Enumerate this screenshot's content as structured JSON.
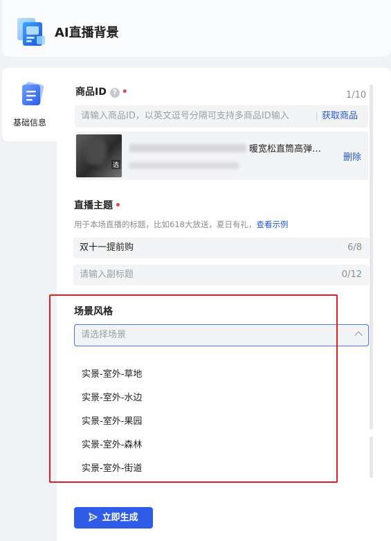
{
  "app": {
    "title": "AI直播背景"
  },
  "sidebar": {
    "items": [
      {
        "label": "基础信息",
        "icon": "document-icon"
      }
    ]
  },
  "form": {
    "product_id": {
      "label": "商品ID",
      "help_icon": "?",
      "required_mark": "•",
      "count": "1/10",
      "placeholder": "请输入商品ID，以英文逗号分隔可支持多商品ID输入",
      "fetch_label": "获取商品"
    },
    "product": {
      "title_visible": "暖宽松直筒高弹…",
      "thumb_tag": "选",
      "delete_label": "删除"
    },
    "theme": {
      "label": "直播主题",
      "required_mark": "•",
      "hint": "用于本场直播的标题，比如618大放送，夏日有礼，",
      "hint_link": "查看示例",
      "value": "双十一提前购",
      "count": "6/8",
      "subtitle_placeholder": "请输入副标题",
      "subtitle_count": "0/12"
    },
    "scene": {
      "label": "场景风格",
      "placeholder": "请选择场景",
      "options": [
        "实景-室外-草地",
        "实景-室外-水边",
        "实景-室外-果园",
        "实景-室外-森林",
        "实景-室外-街道"
      ]
    },
    "submit_label": "立即生成"
  },
  "colors": {
    "accent": "#2e5ce6",
    "link": "#2457d6",
    "required": "#e64545",
    "highlight_box": "#e21f1f"
  }
}
